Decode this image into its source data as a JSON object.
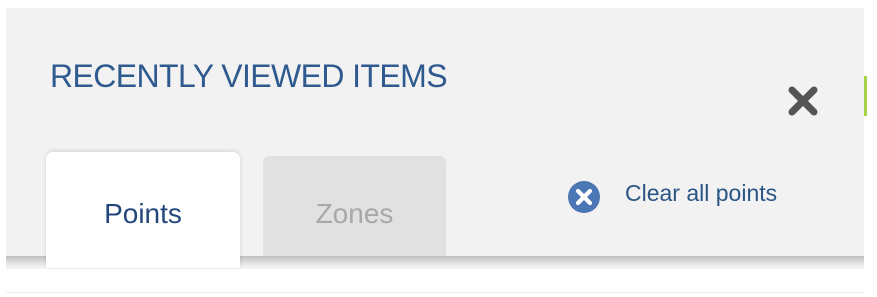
{
  "panel": {
    "title": "RECENTLY VIEWED ITEMS",
    "close_icon": "close-x-icon"
  },
  "tabs": [
    {
      "label": "Points",
      "active": true
    },
    {
      "label": "Zones",
      "active": false
    }
  ],
  "actions": {
    "clear_all_label": "Clear all points",
    "clear_icon": "clear-circle-x-icon"
  },
  "colors": {
    "title": "#2f5a8f",
    "active_tab_text": "#23477a",
    "inactive_tab_text": "#a8a8a8",
    "clear_icon_bg": "#4b76b4",
    "close_icon": "#555555",
    "panel_bg": "#f2f2f2",
    "accent": "#a6d24a"
  }
}
